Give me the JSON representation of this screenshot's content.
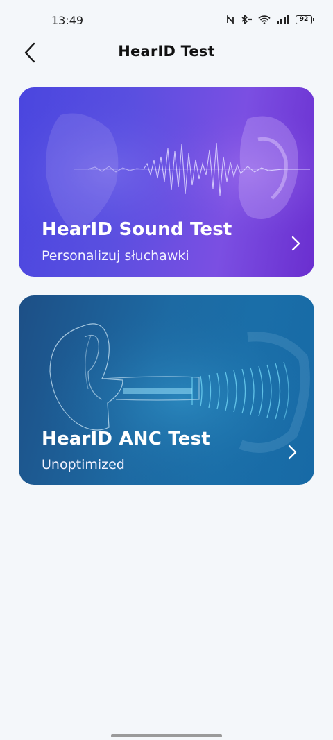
{
  "status_bar": {
    "time": "13:49",
    "battery": "92",
    "icons": [
      "nfc-icon",
      "bluetooth-icon",
      "wifi-icon",
      "signal-icon",
      "battery-icon"
    ]
  },
  "header": {
    "title": "HearID Test",
    "back_icon": "chevron-left-icon"
  },
  "cards": [
    {
      "title": "HearID Sound Test",
      "subtitle": "Personalizuj słuchawki",
      "icon": "chevron-right-icon",
      "accent": "#6a4fe0"
    },
    {
      "title": "HearID ANC Test",
      "subtitle": "Unoptimized",
      "icon": "chevron-right-icon",
      "accent": "#1d6aa3"
    }
  ]
}
